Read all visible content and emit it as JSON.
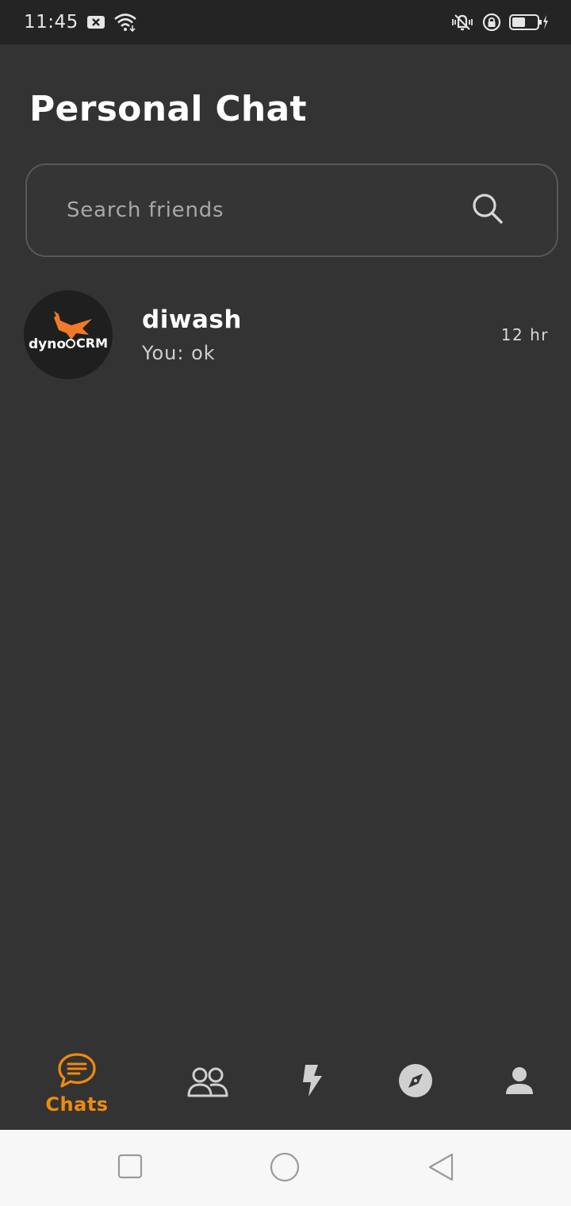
{
  "status_bar": {
    "time": "11:45",
    "icons": [
      "notification-x-icon",
      "wifi-icon",
      "vibrate-icon",
      "lock-rotation-icon",
      "battery-charging-icon"
    ]
  },
  "header": {
    "title": "Personal Chat"
  },
  "search": {
    "placeholder": "Search friends",
    "value": "",
    "icon": "search-icon"
  },
  "chats": [
    {
      "name": "diwash",
      "preview": "You: ok",
      "time": "12 hr",
      "avatar": {
        "logo_text_left": "dyno",
        "logo_text_right": "CRM"
      }
    }
  ],
  "bottom_nav": {
    "items": [
      {
        "id": "chats",
        "label": "Chats",
        "icon": "chat-bubble-icon",
        "active": true
      },
      {
        "id": "friends",
        "label": "",
        "icon": "people-icon",
        "active": false
      },
      {
        "id": "activity",
        "label": "",
        "icon": "lightning-icon",
        "active": false
      },
      {
        "id": "explore",
        "label": "",
        "icon": "compass-icon",
        "active": false
      },
      {
        "id": "profile",
        "label": "",
        "icon": "person-icon",
        "active": false
      }
    ]
  },
  "colors": {
    "background": "#333333",
    "status_bar": "#242424",
    "accent": "#f08a0e",
    "icon_inactive": "#d0d0d0",
    "system_nav": "#f7f7f7"
  }
}
